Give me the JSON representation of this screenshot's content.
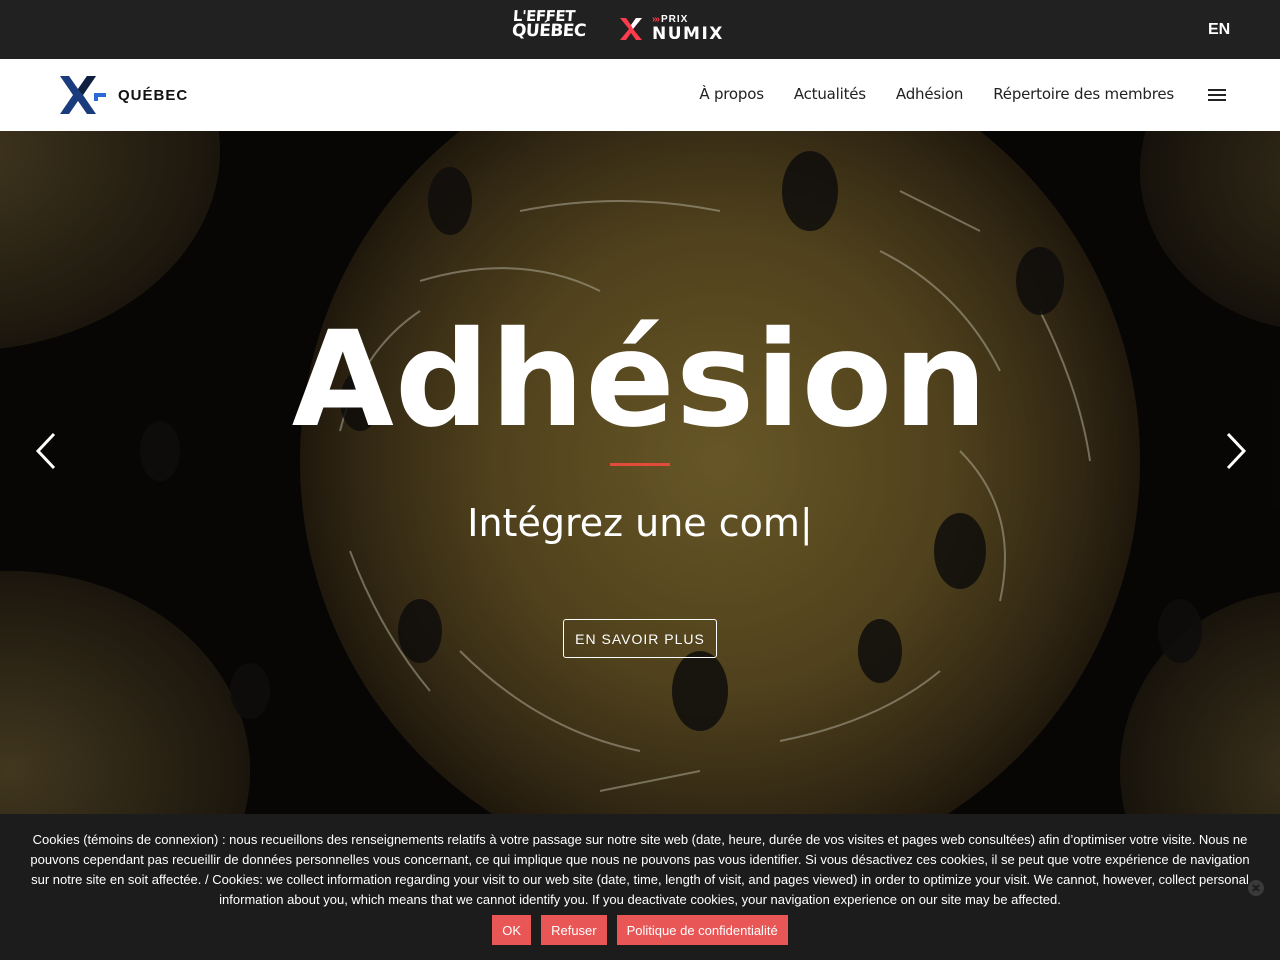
{
  "topbar": {
    "effet_logo_line1": "L'EFFET",
    "effet_logo_line2": "QUÉBEC",
    "numix_prix": "PRIX",
    "numix_word": "NUMIX",
    "lang_toggle": "EN"
  },
  "navbar": {
    "brand_text": "QUÉBEC",
    "links": [
      "À propos",
      "Actualités",
      "Adhésion",
      "Répertoire des membres"
    ],
    "menu_icon": "hamburger-icon"
  },
  "hero": {
    "title": "Adhésion",
    "subtitle": "Intégrez une com|",
    "cta_label": "EN SAVOIR PLUS",
    "prev_icon": "chevron-left-icon",
    "next_icon": "chevron-right-icon",
    "accent_color": "#e14b3a"
  },
  "cookie": {
    "text": "Cookies (témoins de connexion) : nous recueillons des renseignements relatifs à votre passage sur notre site web (date, heure, durée de vos visites et pages web consultées) afin d’optimiser votre visite. Nous ne pouvons cependant pas recueillir de données personnelles vous concernant, ce qui implique que nous ne pouvons pas vous identifier. Si vous désactivez ces cookies, il se peut que votre expérience de navigation sur notre site en soit affectée. / Cookies: we collect information regarding your visit to our web site (date, time, length of visit, and pages viewed) in order to optimize your visit. We cannot, however, collect personal information about you, which means that we cannot identify you. If you deactivate cookies, your navigation experience on our site may be affected.",
    "ok_label": "OK",
    "refuse_label": "Refuser",
    "policy_label": "Politique de confidentialité",
    "button_color": "#e95656",
    "close_icon": "close-icon"
  }
}
